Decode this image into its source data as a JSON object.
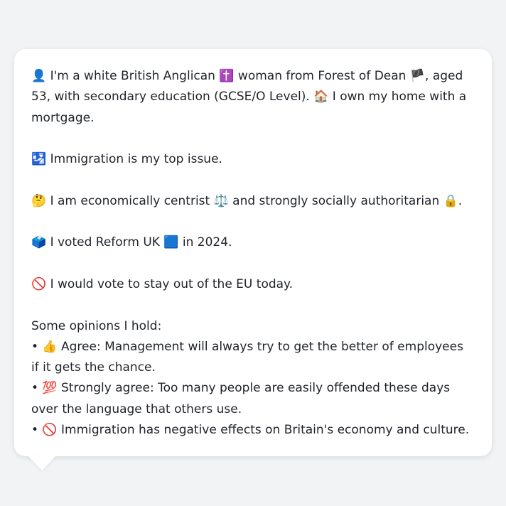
{
  "message": {
    "intro": "👤 I'm a white British Anglican ✝️ woman from Forest of Dean 🏴, aged 53, with secondary education (GCSE/O Level). 🏠 I own my home with a mortgage.",
    "top_issue": "🛂 Immigration is my top issue.",
    "ideology": "🤔 I am economically centrist ⚖️ and strongly socially authoritarian 🔒.",
    "vote_2024": "🗳️ I voted Reform UK 🟦 in 2024.",
    "eu_stance": "🚫 I would vote to stay out of the EU today.",
    "opinions_heading": "Some opinions I hold:",
    "opinions": [
      "• 👍 Agree: Management will always try to get the better of employees if it gets the chance.",
      "• 💯 Strongly agree: Too many people are easily offended these days over the language that others use.",
      "• 🚫 Immigration has negative effects on Britain's economy and culture."
    ]
  }
}
